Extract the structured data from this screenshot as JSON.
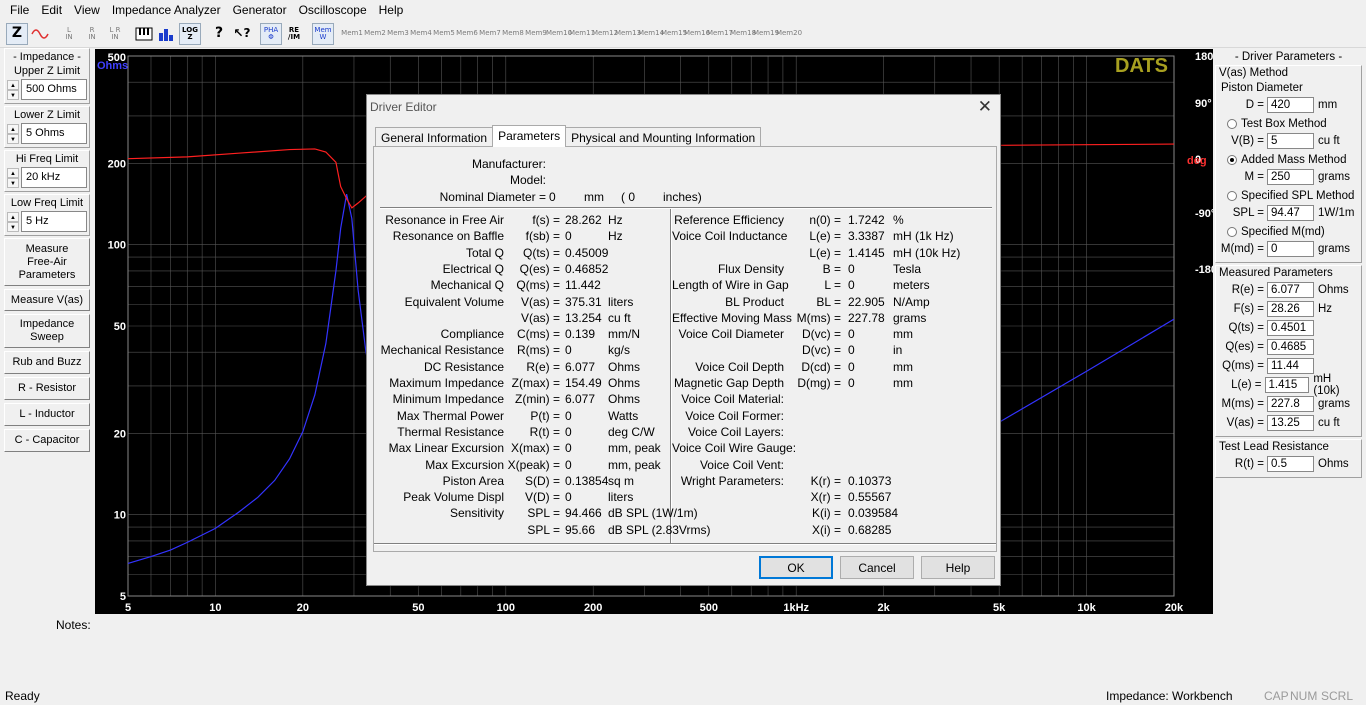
{
  "menu": [
    "File",
    "Edit",
    "View",
    "Impedance Analyzer",
    "Generator",
    "Oscilloscope",
    "Help"
  ],
  "toolbar": {
    "z_label": "Z",
    "pha_label": "PHA\nΦ",
    "reim_label": "RE\n/IM",
    "mem_label": "Mem\nW",
    "mem_slots": [
      "1",
      "2",
      "3",
      "4",
      "5",
      "6",
      "7",
      "8",
      "9",
      "10",
      "11",
      "12",
      "13",
      "14",
      "15",
      "16",
      "17",
      "18",
      "19",
      "20"
    ]
  },
  "left": {
    "impedance_title": "- Impedance -",
    "upper_z_label": "Upper Z Limit",
    "upper_z_value": "500 Ohms",
    "lower_z_label": "Lower Z Limit",
    "lower_z_value": "5 Ohms",
    "hi_freq_label": "Hi Freq Limit",
    "hi_freq_value": "20 kHz",
    "low_freq_label": "Low Freq Limit",
    "low_freq_value": "5 Hz",
    "buttons": [
      "Measure\nFree-Air\nParameters",
      "Measure V(as)",
      "Impedance\nSweep",
      "Rub and Buzz",
      "R - Resistor",
      "L - Inductor",
      "C - Capacitor"
    ]
  },
  "chart_data": {
    "type": "line",
    "title": "DATS",
    "y_unit_label": "Ohms",
    "y_right_unit_label": "deg",
    "x_scale": "log",
    "y_scale": "log",
    "xlim": [
      5,
      20000
    ],
    "ylim": [
      5,
      500
    ],
    "y2lim": [
      -180,
      180
    ],
    "x_ticks": [
      "5",
      "10",
      "20",
      "50",
      "100",
      "200",
      "500",
      "1kHz",
      "2k",
      "5k",
      "10k",
      "20k"
    ],
    "x_tick_values": [
      5,
      10,
      20,
      50,
      100,
      200,
      500,
      1000,
      2000,
      5000,
      10000,
      20000
    ],
    "y_ticks": [
      "500",
      "200",
      "100",
      "50",
      "20",
      "10",
      "5"
    ],
    "y_tick_values": [
      500,
      200,
      100,
      50,
      20,
      10,
      5
    ],
    "y2_ticks": [
      "180°",
      "90°",
      "0",
      "-90°",
      "-180°"
    ],
    "y2_tick_values": [
      180,
      90,
      0,
      -90,
      -180
    ],
    "grid": true,
    "series": [
      {
        "color": "#3333ff",
        "x": [
          5,
          6,
          7,
          8,
          10,
          12,
          14,
          16,
          18,
          20,
          22,
          24,
          26,
          27,
          28.3,
          29.5,
          31,
          33,
          36,
          40,
          50,
          70,
          100,
          200,
          500,
          1000,
          2000,
          5000,
          10000,
          20000
        ],
        "values": [
          6.6,
          7.0,
          7.4,
          7.9,
          8.9,
          10.2,
          11.6,
          13.4,
          16.1,
          20.3,
          27.8,
          43,
          80,
          115,
          154,
          125,
          68,
          40,
          25,
          17,
          11,
          8.5,
          7.8,
          7.9,
          8.6,
          10.3,
          13.5,
          22,
          34,
          53
        ]
      },
      {
        "color": "#ff2020",
        "x": [
          5,
          8,
          12,
          18,
          22,
          24,
          26,
          27,
          28.3,
          29.5,
          31,
          35,
          40,
          60,
          100,
          300,
          1000,
          5000,
          10000,
          20000
        ],
        "values": [
          11,
          14,
          20,
          26,
          27,
          22,
          5,
          -35,
          -55,
          -70,
          -62,
          -40,
          -25,
          -10,
          5,
          20,
          30,
          33,
          34,
          35
        ]
      }
    ]
  },
  "notes_label": "Notes:",
  "status": {
    "ready": "Ready",
    "mode": "Impedance: Workbench",
    "cap": "CAP",
    "num": "NUM",
    "scrl": "SCRL"
  },
  "right": {
    "title": "- Driver Parameters -",
    "vas_title": "V(as) Method",
    "piston_label": "Piston Diameter",
    "d_label": "D =",
    "d_value": "420",
    "d_unit": "mm",
    "testbox_label": "Test Box Method",
    "vb_label": "V(B) =",
    "vb_value": "5",
    "vb_unit": "cu ft",
    "addedmass_label": "Added Mass Method",
    "m_label": "M =",
    "m_value": "250",
    "m_unit": "grams",
    "spl_method_label": "Specified SPL Method",
    "spl_label": "SPL =",
    "spl_value": "94.47",
    "spl_unit": "1W/1m",
    "mmd_method_label": "Specified M(md)",
    "mmd_label": "M(md) =",
    "mmd_value": "0",
    "mmd_unit": "grams",
    "measured_title": "Measured Parameters",
    "measured": [
      {
        "label": "R(e) =",
        "value": "6.077",
        "unit": "Ohms"
      },
      {
        "label": "F(s) =",
        "value": "28.26",
        "unit": "Hz"
      },
      {
        "label": "Q(ts) =",
        "value": "0.4501",
        "unit": ""
      },
      {
        "label": "Q(es) =",
        "value": "0.4685",
        "unit": ""
      },
      {
        "label": "Q(ms) =",
        "value": "11.44",
        "unit": ""
      },
      {
        "label": "L(e) =",
        "value": "1.415",
        "unit": "mH (10k)"
      },
      {
        "label": "M(ms) =",
        "value": "227.8",
        "unit": "grams"
      },
      {
        "label": "V(as) =",
        "value": "13.25",
        "unit": "cu ft"
      }
    ],
    "lead_title": "Test Lead Resistance",
    "rt_label": "R(t) =",
    "rt_value": "0.5",
    "rt_unit": "Ohms"
  },
  "dialog": {
    "title": "Driver Editor",
    "close": "✕",
    "tabs": [
      "General Information",
      "Parameters",
      "Physical and Mounting Information"
    ],
    "manufacturer_label": "Manufacturer:",
    "model_label": "Model:",
    "nominal_label": "Nominal Diameter =",
    "nominal_mm_value": "0",
    "nominal_mm_unit": "mm",
    "nominal_in_paren": "( 0",
    "nominal_in_unit": "inches)",
    "left_params": [
      [
        "Resonance in Free Air",
        "f(s) =",
        "28.262",
        "Hz"
      ],
      [
        "Resonance on Baffle",
        "f(sb) =",
        "0",
        "Hz"
      ],
      [
        "Total Q",
        "Q(ts) =",
        "0.45009",
        ""
      ],
      [
        "Electrical Q",
        "Q(es) =",
        "0.46852",
        ""
      ],
      [
        "Mechanical Q",
        "Q(ms) =",
        "11.442",
        ""
      ],
      [
        "Equivalent Volume",
        "V(as) =",
        "375.31",
        "liters"
      ],
      [
        "",
        "V(as) =",
        "13.254",
        "cu ft"
      ],
      [
        "Compliance",
        "C(ms) =",
        "0.139",
        "mm/N"
      ],
      [
        "Mechanical Resistance",
        "R(ms) =",
        "0",
        "kg/s"
      ],
      [
        "DC Resistance",
        "R(e) =",
        "6.077",
        "Ohms"
      ],
      [
        "Maximum Impedance",
        "Z(max) =",
        "154.49",
        "Ohms"
      ],
      [
        "Minimum Impedance",
        "Z(min) =",
        "6.077",
        "Ohms"
      ],
      [
        "Max Thermal Power",
        "P(t) =",
        "0",
        "Watts"
      ],
      [
        "Thermal Resistance",
        "R(t) =",
        "0",
        "deg C/W"
      ],
      [
        "Max Linear Excursion",
        "X(max) =",
        "0",
        "mm, peak"
      ],
      [
        "Max Excursion",
        "X(peak) =",
        "0",
        "mm, peak"
      ],
      [
        "Piston Area",
        "S(D) =",
        "0.13854",
        "sq m"
      ],
      [
        "Peak Volume Displ",
        "V(D) =",
        "0",
        "liters"
      ],
      [
        "Sensitivity",
        "SPL =",
        "94.466",
        "dB SPL (1W/1m)"
      ],
      [
        "",
        "SPL =",
        "95.66",
        "dB SPL (2.83Vrms)"
      ]
    ],
    "right_params": [
      [
        "Reference Efficiency",
        "n(0) =",
        "1.7242",
        "%"
      ],
      [
        "Voice Coil Inductance",
        "L(e) =",
        "3.3387",
        "mH (1k Hz)"
      ],
      [
        "",
        "L(e) =",
        "1.4145",
        "mH (10k Hz)"
      ],
      [
        "Flux Density",
        "B =",
        "0",
        "Tesla"
      ],
      [
        "Length of Wire in Gap",
        "L =",
        "0",
        "meters"
      ],
      [
        "BL Product",
        "BL =",
        "22.905",
        "N/Amp"
      ],
      [
        "Effective Moving Mass",
        "M(ms) =",
        "227.78",
        "grams"
      ],
      [
        "Voice Coil Diameter",
        "D(vc) =",
        "0",
        "mm"
      ],
      [
        "",
        "D(vc) =",
        "0",
        "in"
      ],
      [
        "Voice Coil Depth",
        "D(cd) =",
        "0",
        "mm"
      ],
      [
        "Magnetic Gap Depth",
        "D(mg) =",
        "0",
        "mm"
      ],
      [
        "Voice Coil Material:",
        "",
        "",
        ""
      ],
      [
        "Voice Coil Former:",
        "",
        "",
        ""
      ],
      [
        "Voice Coil Layers:",
        "",
        "",
        ""
      ],
      [
        "Voice Coil Wire Gauge:",
        "",
        "",
        ""
      ],
      [
        "Voice Coil Vent:",
        "",
        "",
        ""
      ],
      [
        "Wright Parameters:",
        "K(r) =",
        "0.10373",
        ""
      ],
      [
        "",
        "X(r) =",
        "0.55567",
        ""
      ],
      [
        "",
        "K(i) =",
        "0.039584",
        ""
      ],
      [
        "",
        "X(i) =",
        "0.68285",
        ""
      ]
    ],
    "ok": "OK",
    "cancel": "Cancel",
    "help": "Help"
  }
}
